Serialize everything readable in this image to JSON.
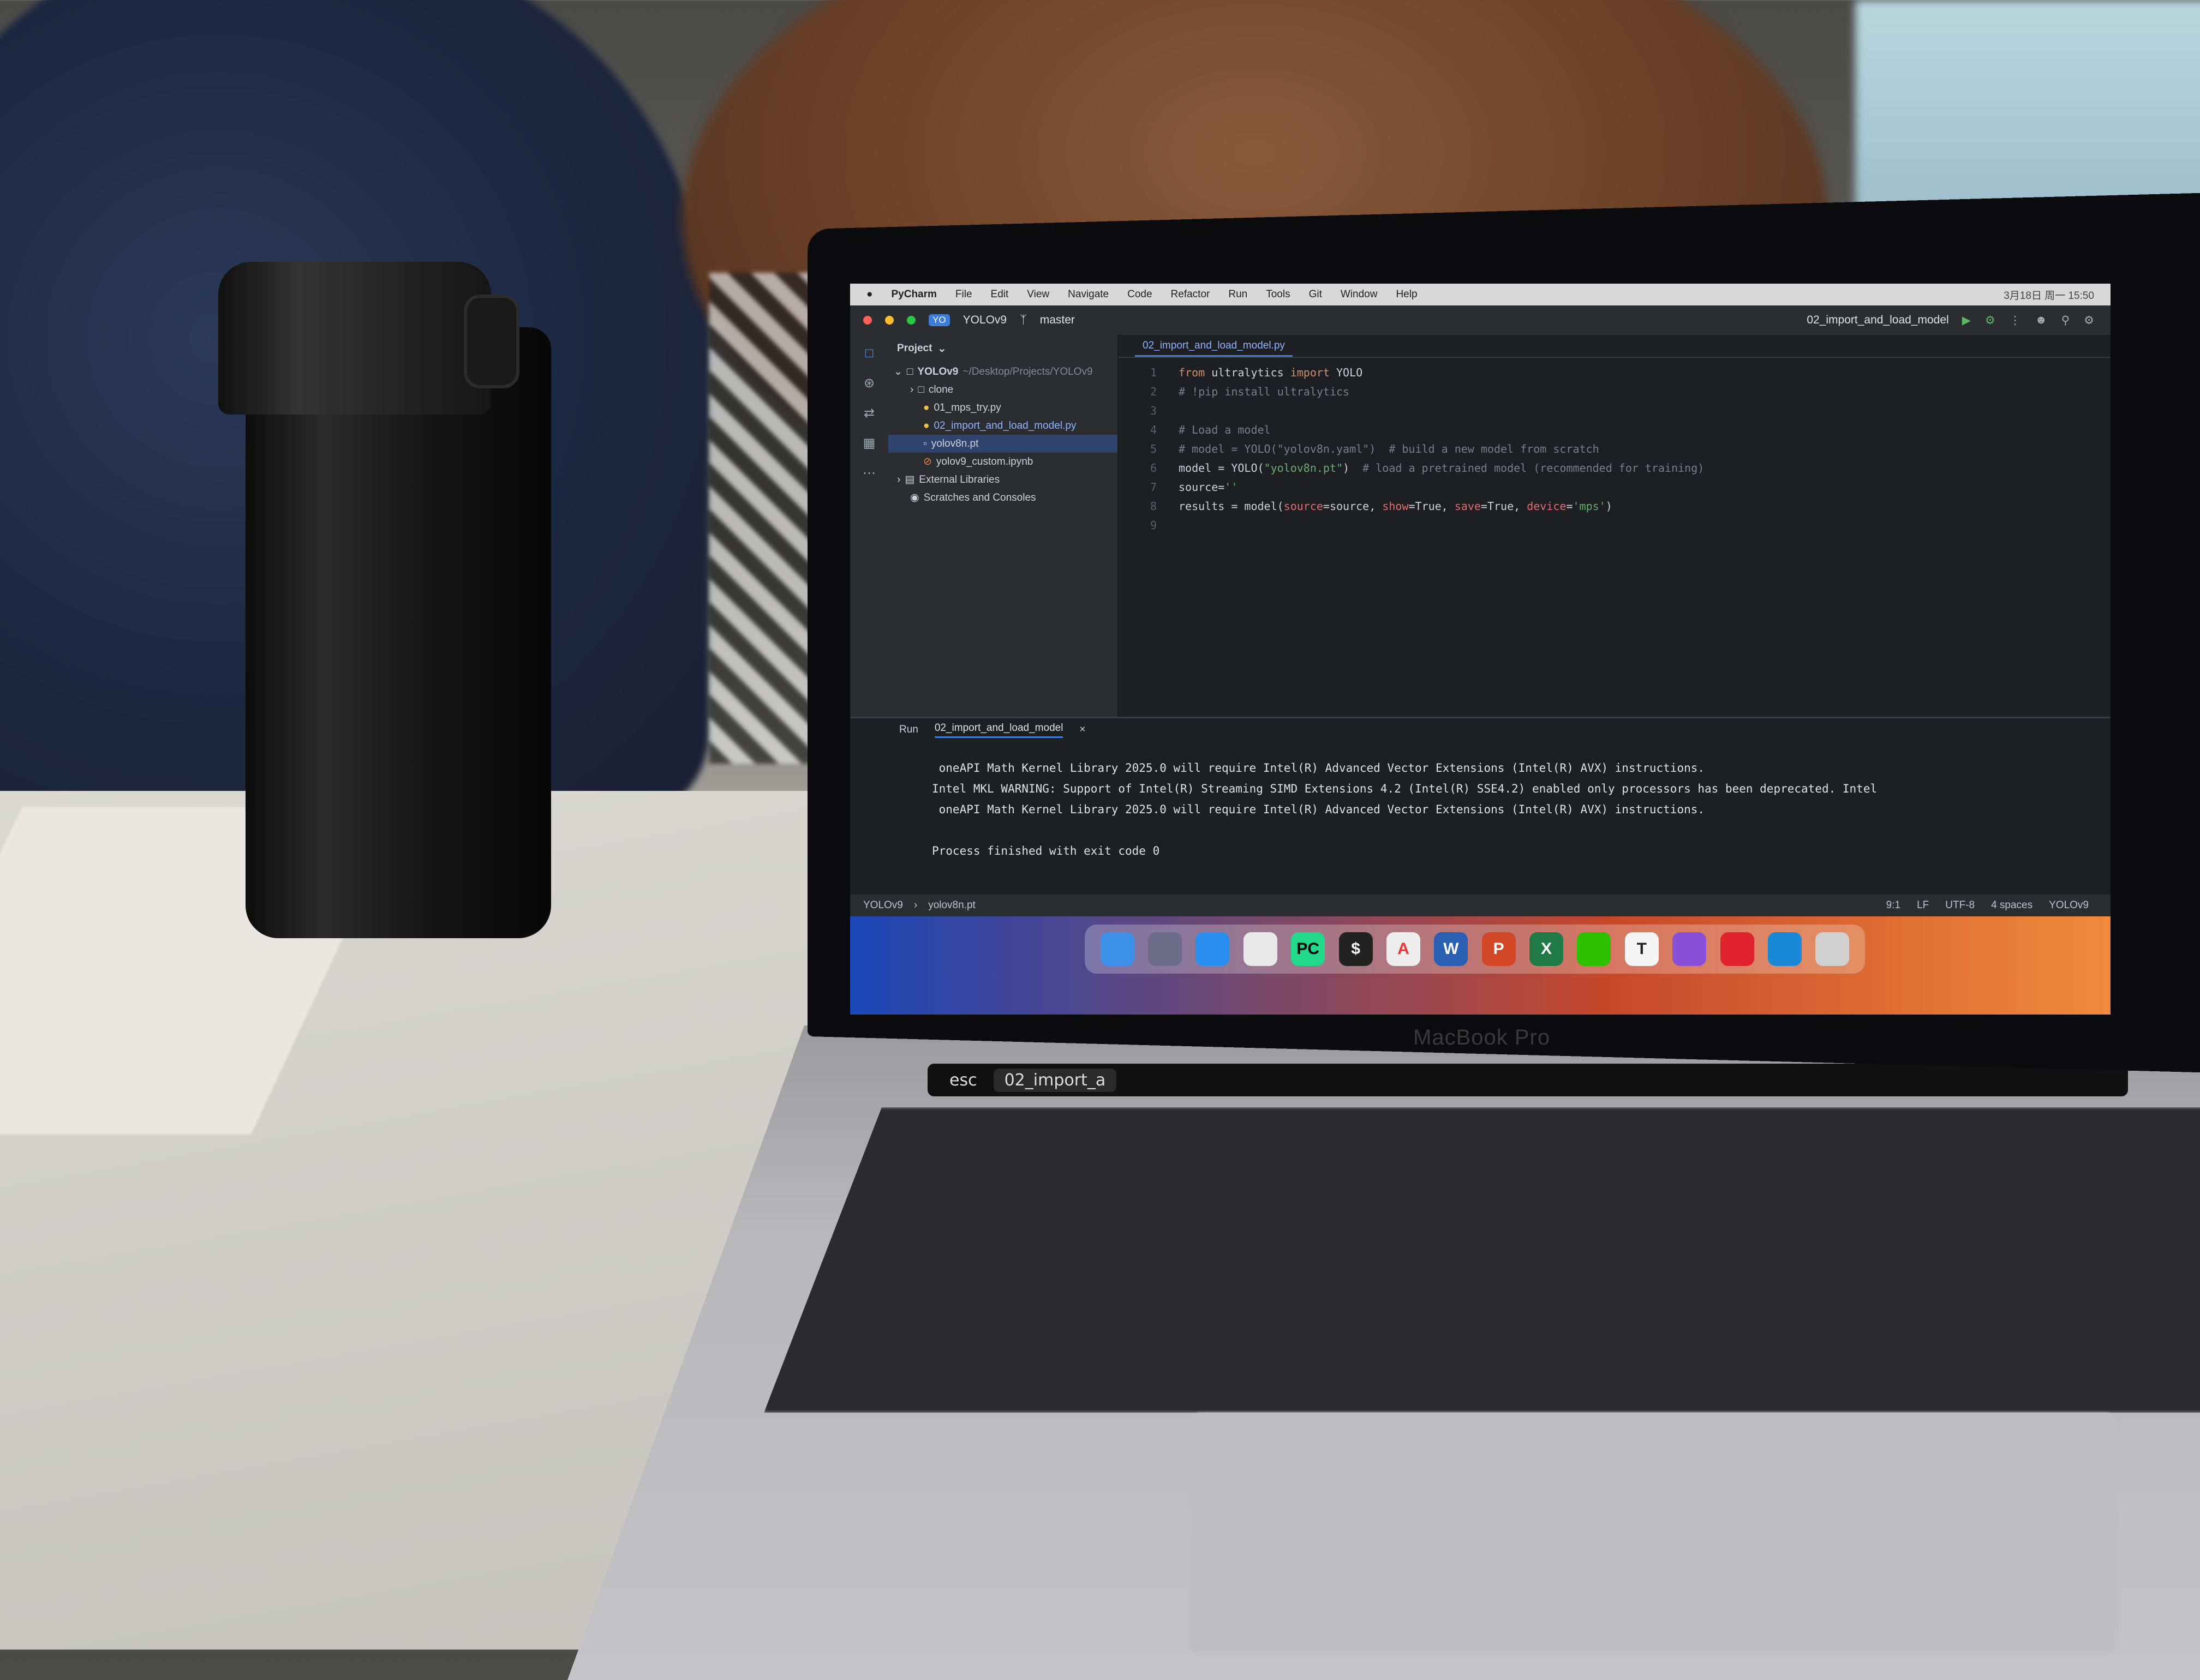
{
  "menubar": {
    "app_name": "PyCharm",
    "items": [
      "File",
      "Edit",
      "View",
      "Navigate",
      "Code",
      "Refactor",
      "Run",
      "Tools",
      "Git",
      "Window",
      "Help"
    ],
    "clock": "3月18日 周一 15:50"
  },
  "toolbar": {
    "project_badge": "YO",
    "project_name": "YOLOv9",
    "branch": "master",
    "run_config": "02_import_and_load_model"
  },
  "project_panel": {
    "title": "Project",
    "tree": [
      {
        "label": "YOLOv9",
        "path": "~/Desktop/Projects/YOLOv9"
      },
      {
        "label": "clone"
      },
      {
        "label": "01_mps_try.py"
      },
      {
        "label": "02_import_and_load_model.py"
      },
      {
        "label": "yolov8n.pt"
      },
      {
        "label": "yolov9_custom.ipynb"
      },
      {
        "label": "External Libraries"
      },
      {
        "label": "Scratches and Consoles"
      }
    ]
  },
  "editor": {
    "tab": "02_import_and_load_model.py",
    "line_numbers": [
      "1",
      "2",
      "3",
      "4",
      "5",
      "6",
      "7",
      "8",
      "9"
    ],
    "code": {
      "l1_kw1": "from",
      "l1_mod": " ultralytics ",
      "l1_kw2": "import",
      "l1_name": " YOLO",
      "l2": "# !pip install ultralytics",
      "l3": "",
      "l4": "# Load a model",
      "l5": "# model = YOLO(\"yolov8n.yaml\")  # build a new model from scratch",
      "l6_a": "model = YOLO(",
      "l6_str": "\"yolov8n.pt\"",
      "l6_b": ")  ",
      "l6_cm": "# load a pretrained model (recommended for training)",
      "l7_a": "source=",
      "l7_str": "''",
      "l8_a": "results = model(",
      "l8_p1": "source",
      "l8_b": "=source, ",
      "l8_p2": "show",
      "l8_c": "=True, ",
      "l8_p3": "save",
      "l8_d": "=True, ",
      "l8_p4": "device",
      "l8_e": "=",
      "l8_str": "'mps'",
      "l8_f": ")",
      "l9": ""
    }
  },
  "run_panel": {
    "label": "Run",
    "tab": "02_import_and_load_model",
    "console": [
      " oneAPI Math Kernel Library 2025.0 will require Intel(R) Advanced Vector Extensions (Intel(R) AVX) instructions.",
      "Intel MKL WARNING: Support of Intel(R) Streaming SIMD Extensions 4.2 (Intel(R) SSE4.2) enabled only processors has been deprecated. Intel",
      " oneAPI Math Kernel Library 2025.0 will require Intel(R) Advanced Vector Extensions (Intel(R) AVX) instructions.",
      "",
      "Process finished with exit code 0"
    ]
  },
  "statusbar": {
    "project": "YOLOv9",
    "file": "yolov8n.pt",
    "position": "9:1",
    "line_ending": "LF",
    "encoding": "UTF-8",
    "indent": "4 spaces",
    "interpreter": "YOLOv9"
  },
  "laptop": {
    "brand": "MacBook Pro",
    "touchbar_label": "02_import_a"
  },
  "dock": {
    "icons": [
      "finder-icon",
      "launchpad-icon",
      "safari-icon",
      "chrome-icon",
      "pycharm-icon",
      "terminal-icon",
      "app-store-icon",
      "word-icon",
      "powerpoint-icon",
      "excel-icon",
      "wechat-icon",
      "typora-icon",
      "github-icon",
      "netease-music-icon",
      "vscode-icon",
      "trash-icon"
    ],
    "letters": [
      "",
      "",
      "",
      "",
      "PC",
      "$",
      "A",
      "W",
      "P",
      "X",
      "",
      "T",
      "",
      "",
      "",
      ""
    ]
  },
  "colors": {
    "ide_bg": "#1e1f22",
    "panel_bg": "#2b2d30",
    "accent": "#3c7dd9",
    "keyword": "#cf8e6d",
    "string": "#6aab73",
    "comment": "#7a7e85"
  }
}
